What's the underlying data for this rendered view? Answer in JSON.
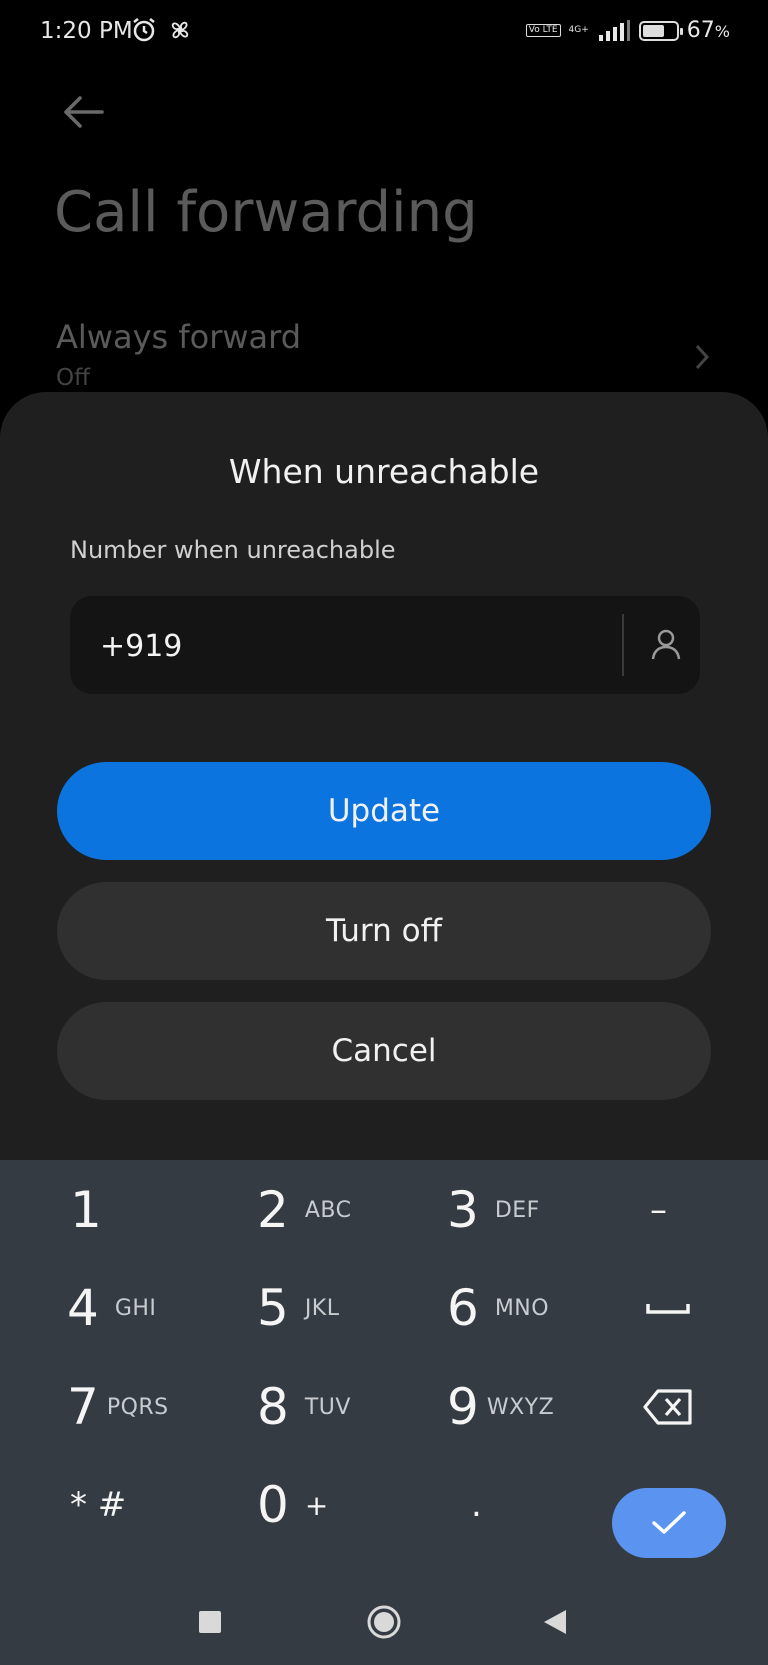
{
  "status_bar": {
    "time": "1:20 PM",
    "network": "4G+",
    "volte": "Vo LTE",
    "battery_percent": "67",
    "battery_suffix": "%",
    "battery_level": 0.67
  },
  "background_page": {
    "title": "Call forwarding",
    "item": {
      "title": "Always forward",
      "subtitle": "Off"
    }
  },
  "dialog": {
    "title": "When unreachable",
    "field_label": "Number when unreachable",
    "number_value": "+919",
    "buttons": {
      "update": "Update",
      "turn_off": "Turn off",
      "cancel": "Cancel"
    }
  },
  "keypad": {
    "keys": [
      {
        "digit": "1",
        "letters": ""
      },
      {
        "digit": "2",
        "letters": "ABC"
      },
      {
        "digit": "3",
        "letters": "DEF"
      },
      {
        "digit": "4",
        "letters": "GHI"
      },
      {
        "digit": "5",
        "letters": "JKL"
      },
      {
        "digit": "6",
        "letters": "MNO"
      },
      {
        "digit": "7",
        "letters": "PQRS"
      },
      {
        "digit": "8",
        "letters": "TUV"
      },
      {
        "digit": "9",
        "letters": "WXYZ"
      },
      {
        "digit": "0",
        "letters": "+"
      }
    ],
    "symbols": {
      "star_hash": "* #",
      "dot": ".",
      "dash": "–"
    }
  },
  "colors": {
    "accent": "#0c74df",
    "check_button": "#5a93f0",
    "keypad_bg": "#343b42",
    "sheet_bg": "#1f1f1f"
  }
}
